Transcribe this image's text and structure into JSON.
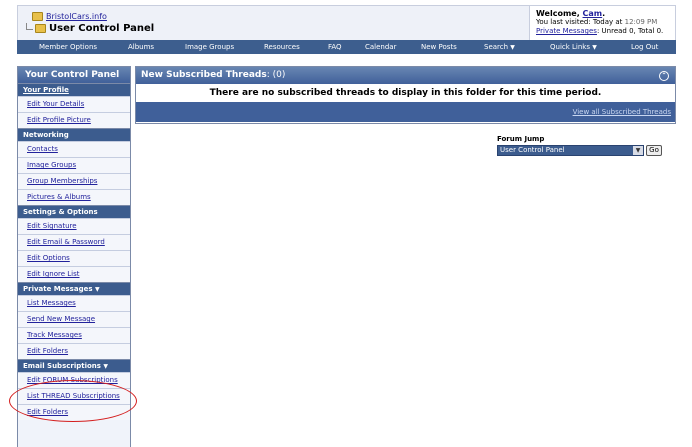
{
  "header": {
    "site_name": "BristolCars.info",
    "panel_title": "User Control Panel",
    "welcome_prefix": "Welcome, ",
    "username": "Cam",
    "welcome_suffix": ".",
    "last_visited_prefix": "You last visited: Today at ",
    "last_visited_time": "12:09 PM",
    "private_messages_link": "Private Messages",
    "private_messages_status": ": Unread 0, Total 0."
  },
  "navbar": {
    "items": [
      {
        "label": "Member Options",
        "dropdown": false
      },
      {
        "label": "Albums",
        "dropdown": false
      },
      {
        "label": "Image Groups",
        "dropdown": false
      },
      {
        "label": "Resources",
        "dropdown": false
      },
      {
        "label": "FAQ",
        "dropdown": false
      },
      {
        "label": "Calendar",
        "dropdown": false
      },
      {
        "label": "New Posts",
        "dropdown": false
      },
      {
        "label": "Search",
        "dropdown": true
      },
      {
        "label": "Quick Links",
        "dropdown": true
      },
      {
        "label": "Log Out",
        "dropdown": false
      }
    ]
  },
  "sidebar": {
    "title": "Your Control Panel",
    "sections": [
      {
        "label": "Your Profile",
        "underline": true,
        "dropdown": false,
        "links": [
          "Edit Your Details",
          "Edit Profile Picture"
        ]
      },
      {
        "label": "Networking",
        "underline": false,
        "dropdown": false,
        "links": [
          "Contacts",
          "Image Groups",
          "Group Memberships",
          "Pictures & Albums"
        ]
      },
      {
        "label": "Settings & Options",
        "underline": false,
        "dropdown": false,
        "links": [
          "Edit Signature",
          "Edit Email & Password",
          "Edit Options",
          "Edit Ignore List"
        ]
      },
      {
        "label": "Private Messages",
        "underline": false,
        "dropdown": true,
        "links": [
          "List Messages",
          "Send New Message",
          "Track Messages",
          "Edit Folders"
        ]
      },
      {
        "label": "Email Subscriptions",
        "underline": false,
        "dropdown": true,
        "links": [
          "Edit FORUM Subscriptions",
          "List THREAD Subscriptions",
          "Edit Folders"
        ]
      }
    ]
  },
  "main": {
    "title": "New Subscribed Threads",
    "count": ": (0)",
    "message": "There are no subscribed threads to display in this folder for this time period.",
    "view_all_link": "View all Subscribed Threads"
  },
  "forum_jump": {
    "label": "Forum Jump",
    "selected": "User Control Panel",
    "go_label": "Go"
  },
  "colors": {
    "nav_bar": "#3d5e8e",
    "header_gradient_top": "#6886b2",
    "header_gradient_bottom": "#40609a",
    "link": "#22229c",
    "highlight": "#d41e1e"
  }
}
